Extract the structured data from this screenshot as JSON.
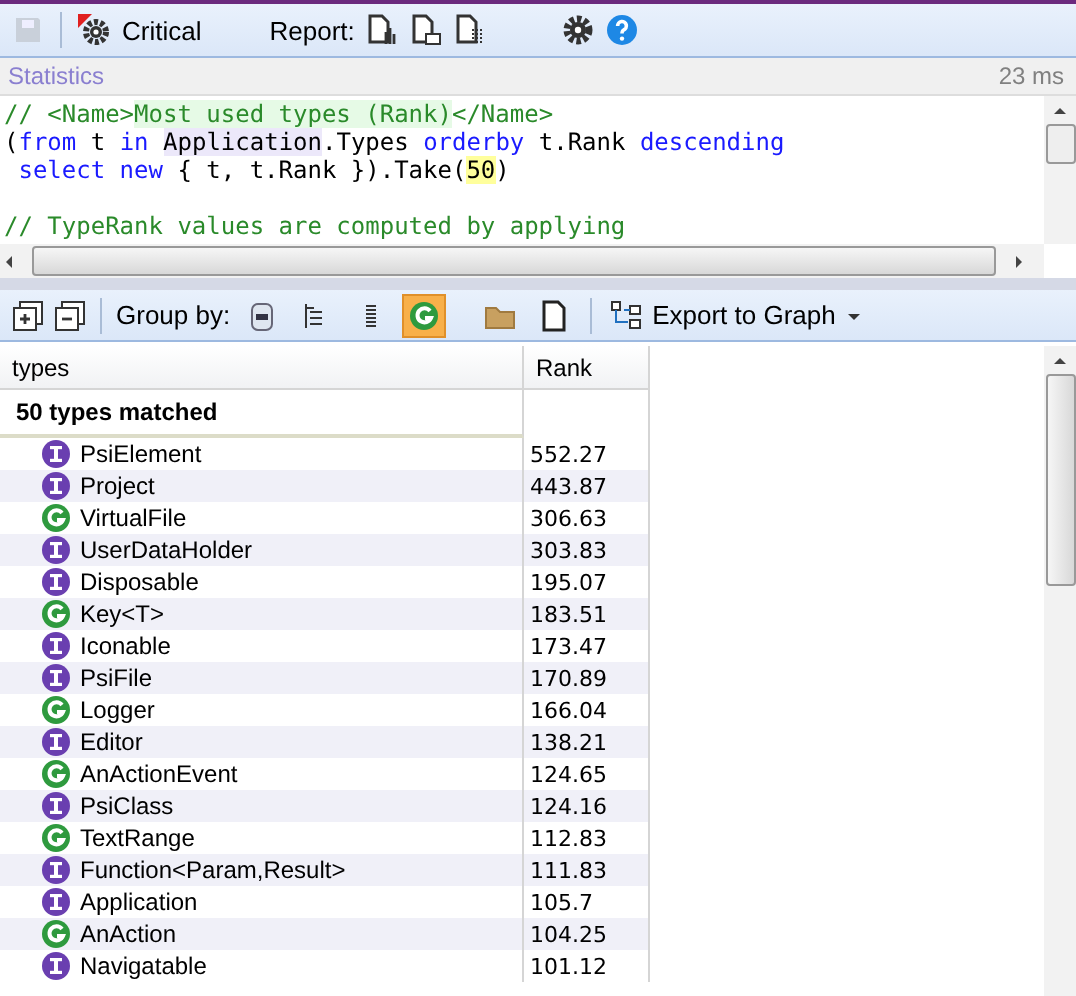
{
  "toolbar": {
    "save_disabled": true,
    "critical_label": "Critical",
    "report_label": "Report:"
  },
  "statistics": {
    "title": "Statistics",
    "elapsed": "23 ms"
  },
  "query_lines": [
    {
      "kind": "code",
      "segments": [
        {
          "kind": "comment",
          "text": "// <Name>"
        },
        {
          "kind": "name",
          "text": "Most used types (Rank)"
        },
        {
          "kind": "comment",
          "text": "</Name>"
        }
      ]
    },
    {
      "kind": "code",
      "segments": [
        {
          "kind": "plain",
          "text": "("
        },
        {
          "kind": "keyword",
          "text": "from"
        },
        {
          "kind": "plain",
          "text": " t "
        },
        {
          "kind": "keyword",
          "text": "in "
        },
        {
          "kind": "type",
          "text": "Application"
        },
        {
          "kind": "plain",
          "text": ".Types "
        },
        {
          "kind": "keyword",
          "text": "orderby"
        },
        {
          "kind": "plain",
          "text": " t.Rank "
        },
        {
          "kind": "keyword",
          "text": "descending"
        }
      ]
    },
    {
      "kind": "code",
      "segments": [
        {
          "kind": "keyword",
          "text": " select"
        },
        {
          "kind": "keyword",
          "text": " new"
        },
        {
          "kind": "plain",
          "text": " { t, t.Rank }).Take("
        },
        {
          "kind": "number",
          "text": "50"
        },
        {
          "kind": "plain",
          "text": ")"
        }
      ]
    },
    {
      "kind": "blank"
    },
    {
      "kind": "code",
      "segments": [
        {
          "kind": "comment",
          "text": "// TypeRank values are computed by applying"
        }
      ]
    }
  ],
  "results_toolbar": {
    "group_by_label": "Group by:",
    "group_by_options": [
      {
        "kind": "assembly",
        "selected": false
      },
      {
        "kind": "namespace",
        "selected": false
      },
      {
        "kind": "flat",
        "selected": false
      },
      {
        "kind": "type",
        "selected": true
      },
      {
        "kind": "folder",
        "selected": false
      },
      {
        "kind": "file",
        "selected": false
      }
    ],
    "export_label": "Export to Graph"
  },
  "table": {
    "columns": [
      "types",
      "Rank"
    ],
    "summary": "50 types matched",
    "rows": [
      {
        "kind": "interface",
        "name": "PsiElement",
        "rank": "552.27"
      },
      {
        "kind": "interface",
        "name": "Project",
        "rank": "443.87"
      },
      {
        "kind": "class",
        "name": "VirtualFile",
        "rank": "306.63"
      },
      {
        "kind": "interface",
        "name": "UserDataHolder",
        "rank": "303.83"
      },
      {
        "kind": "interface",
        "name": "Disposable",
        "rank": "195.07"
      },
      {
        "kind": "class",
        "name": "Key<T>",
        "rank": "183.51"
      },
      {
        "kind": "interface",
        "name": "Iconable",
        "rank": "173.47"
      },
      {
        "kind": "interface",
        "name": "PsiFile",
        "rank": "170.89"
      },
      {
        "kind": "class",
        "name": "Logger",
        "rank": "166.04"
      },
      {
        "kind": "interface",
        "name": "Editor",
        "rank": "138.21"
      },
      {
        "kind": "class",
        "name": "AnActionEvent",
        "rank": "124.65"
      },
      {
        "kind": "interface",
        "name": "PsiClass",
        "rank": "124.16"
      },
      {
        "kind": "class",
        "name": "TextRange",
        "rank": "112.83"
      },
      {
        "kind": "interface",
        "name": "Function<Param,Result>",
        "rank": "111.83"
      },
      {
        "kind": "interface",
        "name": "Application",
        "rank": "105.7"
      },
      {
        "kind": "class",
        "name": "AnAction",
        "rank": "104.25"
      },
      {
        "kind": "interface",
        "name": "Navigatable",
        "rank": "101.12"
      }
    ]
  }
}
